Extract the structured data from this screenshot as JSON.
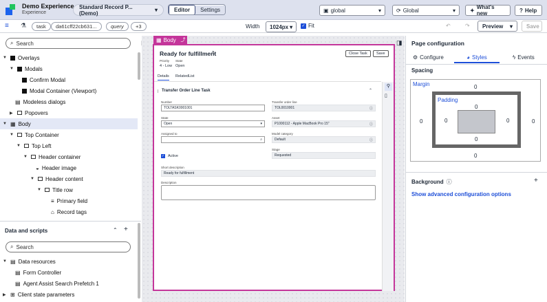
{
  "app": {
    "name": "Demo Experience",
    "subtitle": "Experience"
  },
  "header": {
    "record_page": "Standard Record P... (Demo)",
    "mode_editor": "Editor",
    "mode_settings": "Settings",
    "scope1": "global",
    "scope2": "Global",
    "whats_new": "What's new",
    "help": "Help"
  },
  "toolbar": {
    "tags": [
      "task",
      "da61cff22cb631...",
      "query",
      "+3"
    ],
    "width_label": "Width",
    "width_value": "1024px",
    "fit_label": "Fit",
    "preview": "Preview",
    "save": "Save"
  },
  "left": {
    "search_placeholder": "Search",
    "tree": [
      {
        "label": "Overlays"
      },
      {
        "label": "Modals"
      },
      {
        "label": "Confirm Modal"
      },
      {
        "label": "Modal Container (Viewport)"
      },
      {
        "label": "Modeless dialogs"
      },
      {
        "label": "Popovers"
      },
      {
        "label": "Body"
      },
      {
        "label": "Top Container"
      },
      {
        "label": "Top Left"
      },
      {
        "label": "Header container"
      },
      {
        "label": "Header image"
      },
      {
        "label": "Header content"
      },
      {
        "label": "Title row"
      },
      {
        "label": "Primary field"
      },
      {
        "label": "Record tags"
      }
    ],
    "data_title": "Data and scripts",
    "data_search_placeholder": "Search",
    "data_tree": [
      {
        "label": "Data resources"
      },
      {
        "label": "Form Controller"
      },
      {
        "label": "Agent Assist Search Prefetch 1"
      },
      {
        "label": "Client state parameters"
      }
    ]
  },
  "canvas": {
    "body_tag": "Body",
    "record_title": "Ready for fulfillment",
    "close_task": "Close Task",
    "save": "Save",
    "priority_label": "Priority",
    "priority_value": "4 - Low",
    "state_label": "State",
    "state_value": "Open",
    "tabs": [
      "Details",
      "RelatedList"
    ],
    "section_title": "Transfer Order Line Task",
    "fields": {
      "number_label": "Number",
      "number_value": "TOLTASK0001001",
      "tol_label": "Transfer order line",
      "tol_value": "TOL0010001",
      "state_label": "State",
      "state_value": "Open",
      "asset_label": "Asset",
      "asset_value": "P1000112 - Apple MacBook Pro 15\"",
      "assigned_label": "Assigned to",
      "assigned_value": "",
      "model_label": "Model category",
      "model_value": "Default",
      "active_label": "Active",
      "stage_label": "Stage",
      "stage_value": "Requested",
      "short_desc_label": "Short description",
      "short_desc_value": "Ready for fulfillment",
      "desc_label": "Description"
    }
  },
  "right": {
    "title": "Page configuration",
    "tabs": [
      "Configure",
      "Styles",
      "Events"
    ],
    "spacing": "Spacing",
    "margin": "Margin",
    "padding": "Padding",
    "margin_values": {
      "top": "0",
      "right": "0",
      "bottom": "0",
      "left": "0"
    },
    "padding_values": {
      "top": "0",
      "right": "0",
      "bottom": "0",
      "left": "0"
    },
    "background": "Background",
    "advanced": "Show advanced configuration options"
  },
  "colors": {
    "accent": "#c4359a",
    "link": "#1d4ed8",
    "topbar": "#dde1ee"
  }
}
